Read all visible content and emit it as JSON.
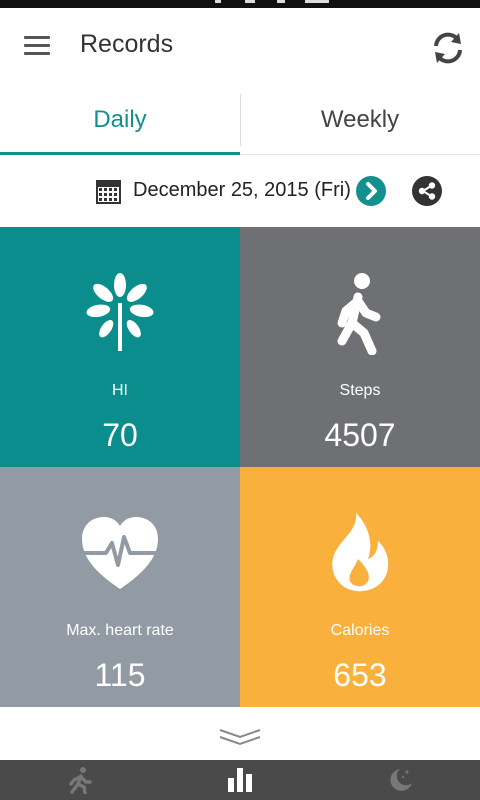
{
  "app": {
    "title": "Records"
  },
  "header": {
    "menu_icon": "hamburger-menu-icon",
    "refresh_icon": "refresh-icon"
  },
  "tabs": [
    {
      "label": "Daily",
      "selected": true
    },
    {
      "label": "Weekly",
      "selected": false
    }
  ],
  "date_bar": {
    "calendar_icon": "calendar-icon",
    "date": "December 25, 2015 (Fri)",
    "next_icon": "chevron-right-icon",
    "share_icon": "share-icon"
  },
  "tiles": [
    {
      "label": "HI",
      "value": "70",
      "icon": "tree-icon",
      "color": "#0a8d8c"
    },
    {
      "label": "Steps",
      "value": "4507",
      "icon": "walking-person-icon",
      "color": "#6e7073"
    },
    {
      "label": "Max. heart rate",
      "value": "115",
      "icon": "heart-rate-icon",
      "color": "#929ba3"
    },
    {
      "label": "Calories",
      "value": "653",
      "icon": "flame-icon",
      "color": "#fab03d"
    }
  ],
  "expand_icon": "double-chevron-down-icon",
  "bottom_nav": [
    {
      "icon": "running-person-icon",
      "active": false
    },
    {
      "icon": "bar-chart-icon",
      "active": true
    },
    {
      "icon": "moon-stars-icon",
      "active": false
    }
  ],
  "colors": {
    "accent": "#12908e",
    "nav_bg": "#4a4a4a"
  }
}
